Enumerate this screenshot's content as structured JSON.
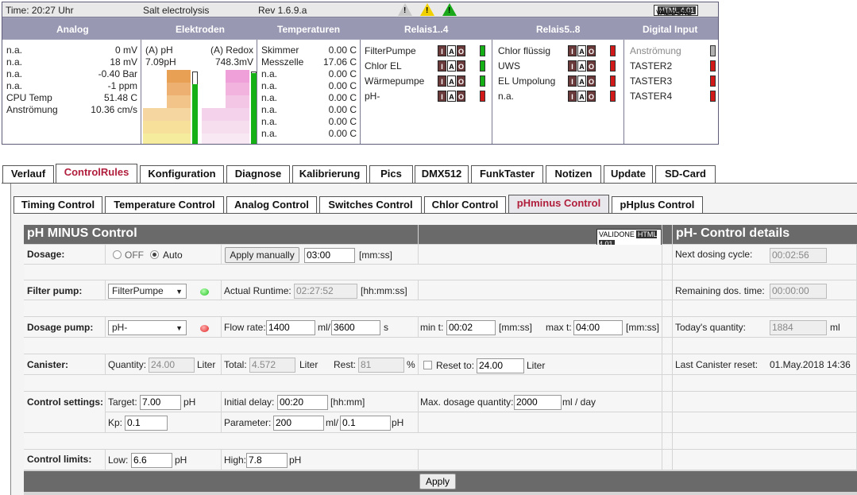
{
  "status": {
    "time": "Time: 20:27 Uhr",
    "title": "Salt electrolysis",
    "rev": "Rev 1.6.9.a",
    "logo_brand": "VALIDONE",
    "logo_version": "HTML 4.01",
    "headers": [
      "Analog",
      "Elektroden",
      "Temperaturen",
      "Relais1..4",
      "Relais5..8",
      "Digital Input"
    ],
    "analog": [
      {
        "label": "n.a.",
        "value": "0 mV"
      },
      {
        "label": "n.a.",
        "value": "18 mV"
      },
      {
        "label": "n.a.",
        "value": "-0.40 Bar"
      },
      {
        "label": "n.a.",
        "value": "-1 ppm"
      },
      {
        "label": "CPU Temp",
        "value": "51.48 C"
      },
      {
        "label": "Anströmung",
        "value": "10.36 cm/s"
      }
    ],
    "electrodes": {
      "ph_label": "(A) pH",
      "ph_value": "7.09pH",
      "redox_label": "(A) Redox",
      "redox_value": "748.3mV"
    },
    "temperatures": [
      {
        "label": "Skimmer",
        "value": "0.00 C"
      },
      {
        "label": "Messzelle",
        "value": "17.06 C"
      },
      {
        "label": "n.a.",
        "value": "0.00 C"
      },
      {
        "label": "n.a.",
        "value": "0.00 C"
      },
      {
        "label": "n.a.",
        "value": "0.00 C"
      },
      {
        "label": "n.a.",
        "value": "0.00 C"
      },
      {
        "label": "n.a.",
        "value": "0.00 C"
      },
      {
        "label": "n.a.",
        "value": "0.00 C"
      }
    ],
    "iao": [
      "I",
      "A",
      "O"
    ],
    "relais1": [
      {
        "label": "FilterPumpe",
        "state": "green"
      },
      {
        "label": "Chlor EL",
        "state": "green"
      },
      {
        "label": "Wärmepumpe",
        "state": "green"
      },
      {
        "label": "pH-",
        "state": "red"
      }
    ],
    "relais2": [
      {
        "label": "Chlor flüssig",
        "state": "red"
      },
      {
        "label": "UWS",
        "state": "red"
      },
      {
        "label": "EL Umpolung",
        "state": "red"
      },
      {
        "label": "n.a.",
        "state": "red"
      }
    ],
    "digital": [
      {
        "label": "Anströmung",
        "state": "grey"
      },
      {
        "label": "TASTER2",
        "state": "red"
      },
      {
        "label": "TASTER3",
        "state": "red"
      },
      {
        "label": "TASTER4",
        "state": "red"
      }
    ]
  },
  "tabs": [
    "Verlauf",
    "ControlRules",
    "Konfiguration",
    "Diagnose",
    "Kalibrierung",
    "Pics",
    "DMX512",
    "FunkTaster",
    "Notizen",
    "Update",
    "SD-Card"
  ],
  "active_tab": "ControlRules",
  "subtabs": [
    "Timing Control",
    "Temperature Control",
    "Analog Control",
    "Switches Control",
    "Chlor Control",
    "pHminus Control",
    "pHplus Control"
  ],
  "active_subtab": "pHminus Control",
  "form": {
    "title": "pH MINUS Control",
    "details_title": "pH- Control details",
    "dosage": {
      "label": "Dosage:",
      "off": "OFF",
      "auto": "Auto",
      "apply_manually": "Apply manually",
      "time": "03:00",
      "unit": "[mm:ss]"
    },
    "filter": {
      "label": "Filter pump:",
      "select": "FilterPumpe",
      "runtime_label": "Actual Runtime:",
      "runtime": "02:27:52",
      "runtime_unit": "[hh:mm:ss]"
    },
    "pump": {
      "label": "Dosage pump:",
      "select": "pH-",
      "flow_label": "Flow rate:",
      "flow": "1400",
      "flow_unit": "ml/",
      "flow2": "3600",
      "flow2_unit": "s",
      "min_label": "min t:",
      "min": "00:02",
      "min_unit": "[mm:ss]",
      "max_label": "max t:",
      "max": "04:00",
      "max_unit": "[mm:ss]"
    },
    "canister": {
      "label": "Canister:",
      "qty_label": "Quantity:",
      "qty": "24.00",
      "qty_unit": "Liter",
      "total_label": "Total:",
      "total": "4.572",
      "total_unit": "Liter",
      "rest_label": "Rest:",
      "rest": "81",
      "rest_unit": "%",
      "reset_label": "Reset to:",
      "reset": "24.00",
      "reset_unit": "Liter"
    },
    "settings": {
      "label": "Control settings:",
      "target_label": "Target:",
      "target": "7.00",
      "target_unit": "pH",
      "delay_label": "Initial delay:",
      "delay": "00:20",
      "delay_unit": "[hh:mm]",
      "max_label": "Max. dosage quantity:",
      "max": "2000",
      "max_unit": "ml / day",
      "kp_label": "Kp:",
      "kp": "0.1",
      "param_label": "Parameter:",
      "param1": "200",
      "param_unit": "ml/",
      "param2": "0.1",
      "param2_unit": "pH"
    },
    "limits": {
      "label": "Control limits:",
      "low_label": "Low:",
      "low": "6.6",
      "low_unit": "pH",
      "high_label": "High:",
      "high": "7.8",
      "high_unit": "pH"
    },
    "apply": "Apply",
    "details": {
      "next_label": "Next dosing cycle:",
      "next": "00:02:56",
      "remaining_label": "Remaining dos. time:",
      "remaining": "00:00:00",
      "today_label": "Today's quantity:",
      "today": "1884",
      "today_unit": "ml",
      "reset_label": "Last Canister reset:",
      "reset": "01.May.2018 14:36"
    }
  }
}
